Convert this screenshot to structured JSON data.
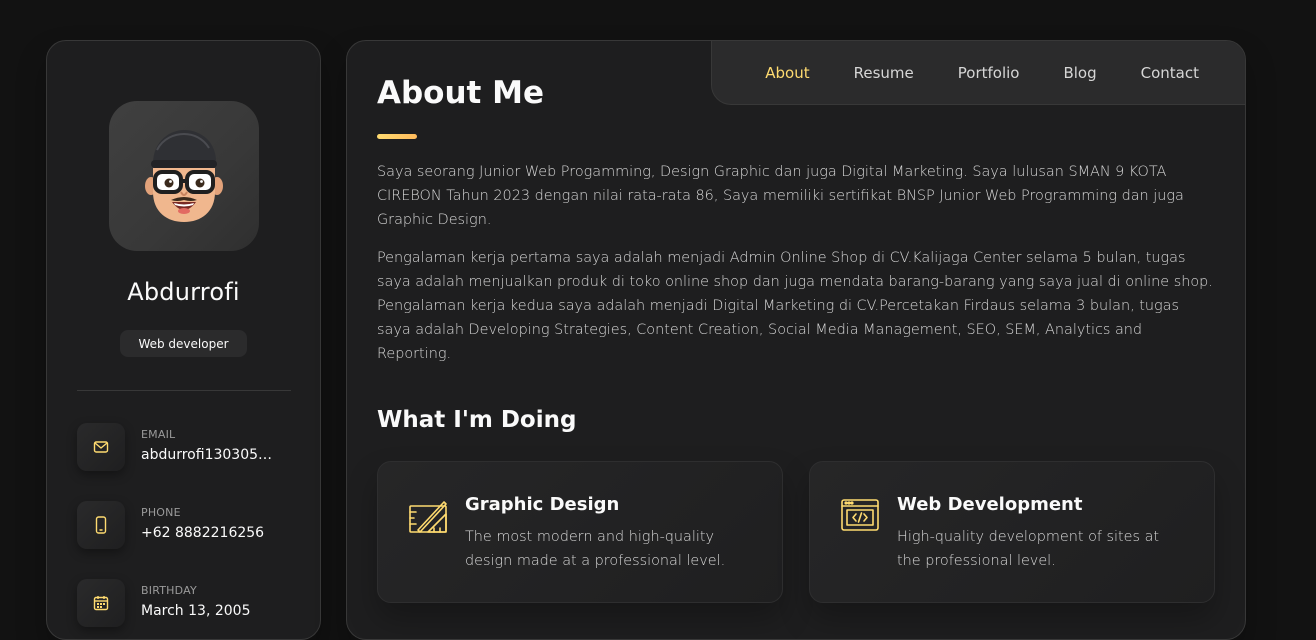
{
  "profile": {
    "name": "Abdurrofi",
    "role": "Web developer",
    "contacts": [
      {
        "label": "Email",
        "value": "abdurrofi130305@g...",
        "icon": "mail-icon"
      },
      {
        "label": "Phone",
        "value": "+62 8882216256",
        "icon": "phone-icon"
      },
      {
        "label": "Birthday",
        "value": "March 13, 2005",
        "icon": "calendar-icon"
      }
    ]
  },
  "nav": {
    "items": [
      "About",
      "Resume",
      "Portfolio",
      "Blog",
      "Contact"
    ],
    "active": "About"
  },
  "about": {
    "title": "About Me",
    "paragraphs": [
      "Saya seorang Junior Web Progamming, Design Graphic dan juga Digital Marketing. Saya lulusan SMAN 9 KOTA CIREBON Tahun 2023 dengan nilai rata-rata 86, Saya memiliki sertifikat BNSP Junior Web Programming dan juga Graphic Design.",
      "Pengalaman kerja pertama saya adalah menjadi Admin Online Shop di CV.Kalijaga Center selama 5 bulan, tugas saya adalah menjualkan produk di toko online shop dan juga mendata barang-barang yang saya jual di online shop. Pengalaman kerja kedua saya adalah menjadi Digital Marketing di CV.Percetakan Firdaus selama 3 bulan, tugas saya adalah Developing Strategies, Content Creation, Social Media Management, SEO, SEM, Analytics and Reporting."
    ]
  },
  "services": {
    "title": "What I'm Doing",
    "items": [
      {
        "title": "Graphic Design",
        "desc": "The most modern and high-quality design made at a professional level.",
        "icon": "design-icon"
      },
      {
        "title": "Web Development",
        "desc": "High-quality development of sites at the professional level.",
        "icon": "code-icon"
      }
    ]
  },
  "colors": {
    "accent": "#ffdb70",
    "background": "#121212",
    "card": "#1e1e1f"
  }
}
